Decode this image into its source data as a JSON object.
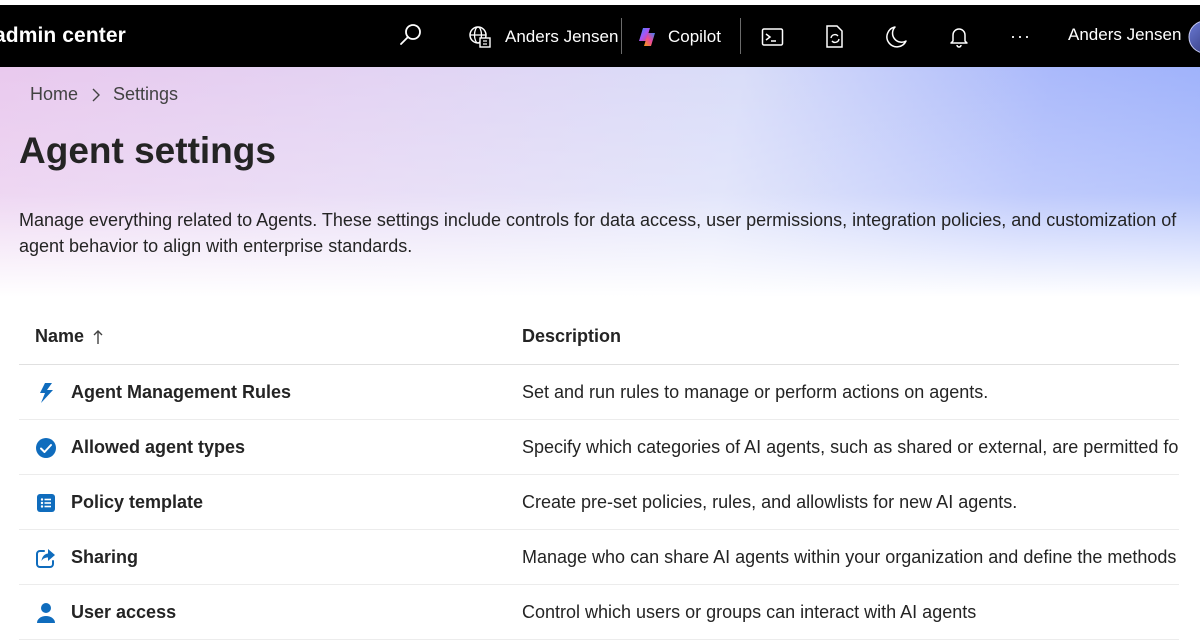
{
  "topbar": {
    "app_title": "admin center",
    "search_label": "Search",
    "tenant_name": "Anders Jensen",
    "copilot_label": "Copilot",
    "more_label": "···",
    "user_name": "Anders Jensen"
  },
  "breadcrumb": {
    "home": "Home",
    "current": "Settings"
  },
  "page": {
    "title": "Agent settings",
    "description": "Manage everything related to Agents. These settings include controls for data access, user permissions, integration policies, and customization of agent behavior to align with enterprise standards."
  },
  "table": {
    "columns": {
      "name": "Name",
      "description": "Description"
    },
    "sort_indicator": "↑",
    "rows": [
      {
        "name": "Agent Management Rules",
        "description": "Set and run rules to manage or perform actions on agents.",
        "icon": "lightning-icon"
      },
      {
        "name": "Allowed agent types",
        "description": "Specify which categories of AI agents, such as shared or external, are permitted for",
        "icon": "checkmark-circle-icon"
      },
      {
        "name": "Policy template",
        "description": "Create pre-set policies, rules, and allowlists for new AI agents.",
        "icon": "list-icon"
      },
      {
        "name": "Sharing",
        "description": "Manage who can share AI agents within your organization and define the methods",
        "icon": "share-icon"
      },
      {
        "name": "User access",
        "description": "Control which users or groups can interact with AI agents",
        "icon": "person-icon"
      }
    ]
  },
  "colors": {
    "topbar_bg": "#000000",
    "accent_blue": "#0f6cbd",
    "text": "#242424"
  }
}
